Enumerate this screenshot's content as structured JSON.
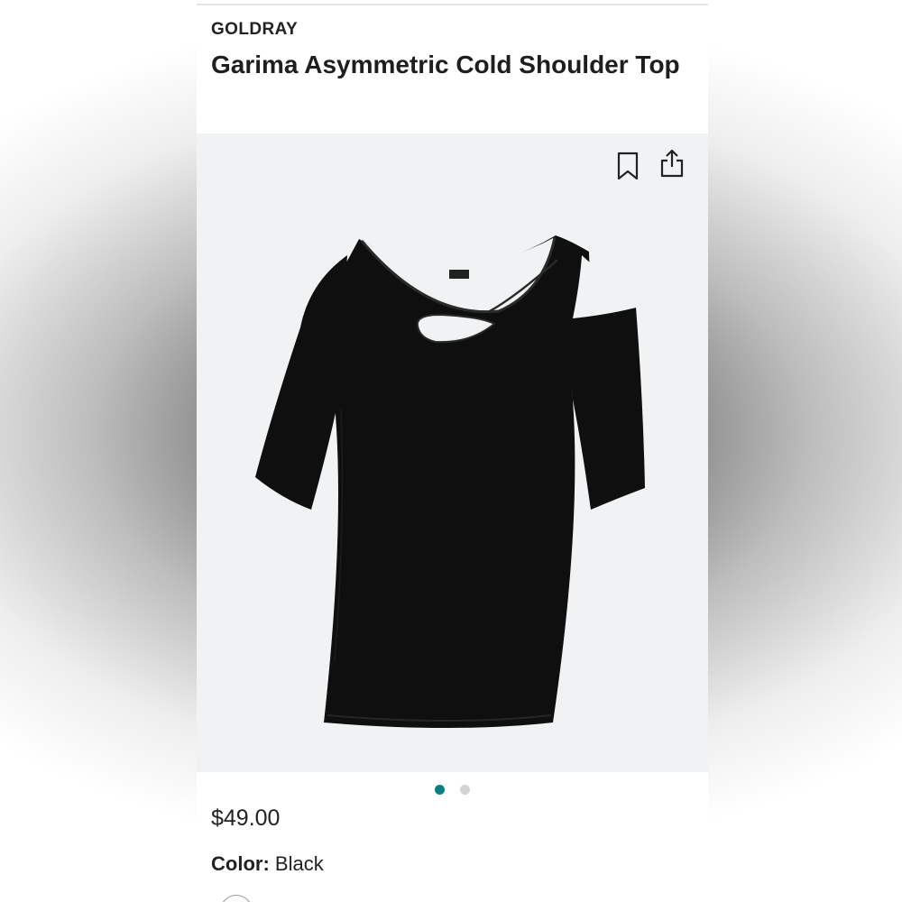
{
  "product": {
    "brand": "GOLDRAY",
    "title": "Garima Asymmetric Cold Shoulder Top",
    "price": "$49.00",
    "color_label": "Color:",
    "color_value": "Black"
  },
  "gallery": {
    "image_subject": "black asymmetric cold shoulder top",
    "image_count": 2,
    "active_index": 0,
    "icons": [
      "bookmark-icon",
      "share-icon"
    ]
  },
  "colors": {
    "active_dot": "#0b7f7f",
    "inactive_dot": "#d4d4d4",
    "gallery_bg": "#f1f2f4",
    "garment": "#0f0f0f"
  }
}
